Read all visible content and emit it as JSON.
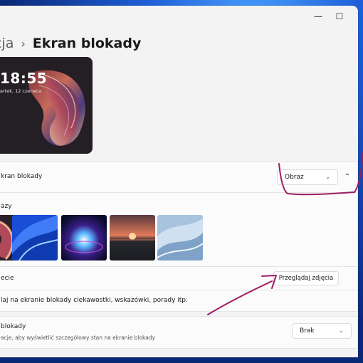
{
  "window": {
    "controls": {
      "minimize": "—",
      "maximize": "☐",
      "close": "✕"
    }
  },
  "breadcrumb": {
    "parent": "cja",
    "separator": "›",
    "current": "Ekran blokady"
  },
  "preview": {
    "time": "18:55",
    "date": "artek, 12 czerwca"
  },
  "lock_screen_setting": {
    "label": "kran blokady",
    "dropdown_value": "Obraz",
    "expand_icon": "chevron-up-icon"
  },
  "recent_images": {
    "label": "azy",
    "thumbnails": [
      {
        "name": "ribbon-wallpaper"
      },
      {
        "name": "blue-windows-flow"
      },
      {
        "name": "dark-bloom"
      },
      {
        "name": "sunset-lake"
      },
      {
        "name": "soft-blue-waves"
      }
    ]
  },
  "choose_photo": {
    "label": "ecie",
    "button_label": "Przeglądaj zdjęcia"
  },
  "fun_facts": {
    "label": "laj na ekranie blokady ciekawostki, wskazówki, porady itp."
  },
  "lock_status": {
    "label": "blokady",
    "description": "acje, aby wyświetlić szczegółowy stan na ekranie blokady",
    "dropdown_value": "Brak"
  },
  "colors": {
    "window_bg": "#f3f3f3",
    "card_bg": "#fbfbfb",
    "annotation": "#9c1d64"
  }
}
